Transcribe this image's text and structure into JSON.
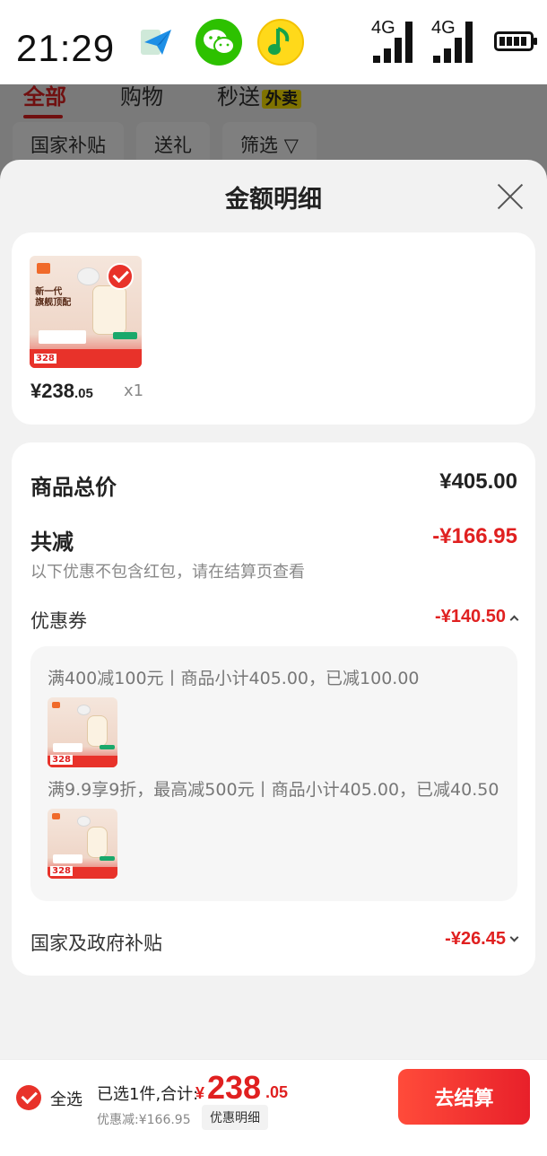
{
  "status_bar": {
    "time": "21:29",
    "apps": [
      "send-icon",
      "wechat-icon",
      "music-icon"
    ],
    "signal_1": "4G",
    "signal_2": "4G",
    "battery_icon": "battery-icon"
  },
  "background_page": {
    "tabs": [
      {
        "label": "全部",
        "active": true
      },
      {
        "label": "购物",
        "active": false
      },
      {
        "label": "秒送",
        "badge": "外卖",
        "active": false
      }
    ],
    "chips": [
      "国家补贴",
      "送礼",
      "筛选"
    ]
  },
  "sheet": {
    "title": "金额明细",
    "product": {
      "thumb_text": "新一代\n旗舰顶配",
      "thumb_price": "328",
      "price_symbol": "¥",
      "price_int": "238",
      "price_cents": ".05",
      "quantity": "x1"
    },
    "total_label": "商品总价",
    "total_value": "¥405.00",
    "reduce_label": "共减",
    "reduce_value": "-¥166.95",
    "reduce_note": "以下优惠不包含红包，请在结算页查看",
    "coupon_label": "优惠券",
    "coupon_value": "-¥140.50",
    "coupons": [
      {
        "text": "满400减100元丨商品小计405.00，已减100.00"
      },
      {
        "text": "满9.9享9折，最高减500元丨商品小计405.00，已减40.50"
      }
    ],
    "subsidy_label": "国家及政府补贴",
    "subsidy_value": "-¥26.45"
  },
  "bottom_bar": {
    "select_all": "全选",
    "summary": "已选1件,合计:",
    "total_currency": "¥",
    "total_int": "238",
    "total_cents": ".05",
    "discount": "优惠减:¥166.95",
    "detail_button": "优惠明细",
    "checkout": "去结算"
  },
  "colors": {
    "accent_red": "#e02020",
    "button_red": "#ff4b3a",
    "wechat_green": "#2dc100",
    "music_yellow": "#ffd91a"
  }
}
